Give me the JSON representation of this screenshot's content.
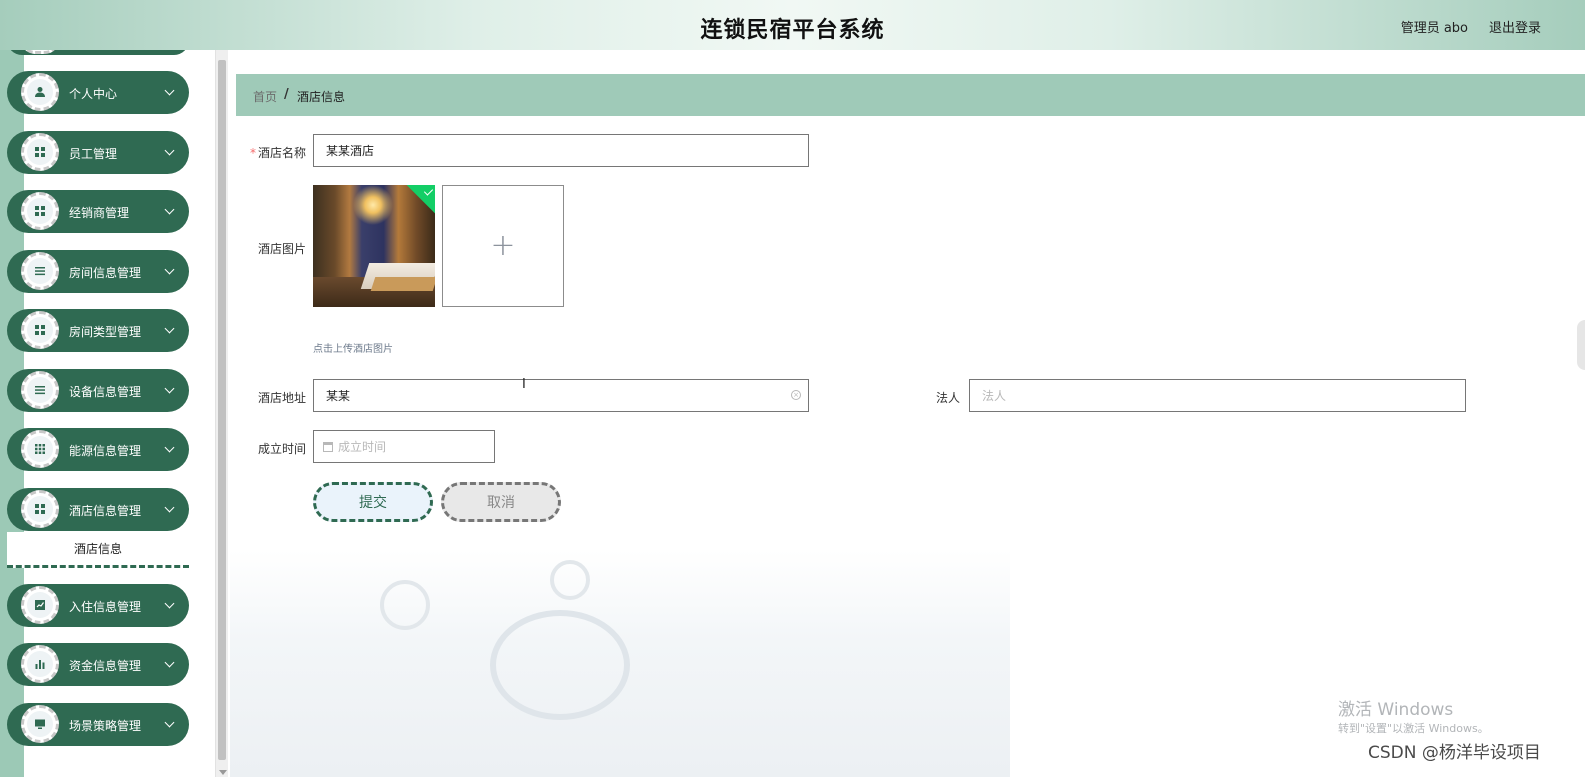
{
  "header": {
    "title": "连锁民宿平台系统",
    "user": "管理员 abo",
    "logout": "退出登录"
  },
  "sidebar": {
    "items": [
      {
        "label": "个人中心",
        "icon": "person-icon"
      },
      {
        "label": "员工管理",
        "icon": "grid-icon"
      },
      {
        "label": "经销商管理",
        "icon": "grid-icon"
      },
      {
        "label": "房间信息管理",
        "icon": "list-icon"
      },
      {
        "label": "房间类型管理",
        "icon": "grid-icon"
      },
      {
        "label": "设备信息管理",
        "icon": "list-icon"
      },
      {
        "label": "能源信息管理",
        "icon": "grid-dots-icon"
      },
      {
        "label": "酒店信息管理",
        "icon": "grid-icon"
      },
      {
        "label": "入住信息管理",
        "icon": "chart-line-icon"
      },
      {
        "label": "资金信息管理",
        "icon": "bar-chart-icon"
      },
      {
        "label": "场景策略管理",
        "icon": "monitor-icon"
      }
    ],
    "active_submenu": "酒店信息"
  },
  "breadcrumb": {
    "home": "首页",
    "separator": "/",
    "current": "酒店信息"
  },
  "form": {
    "hotel_name": {
      "label": "酒店名称",
      "required_mark": "*",
      "value": "某某酒店"
    },
    "hotel_image": {
      "label": "酒店图片",
      "tip": "点击上传酒店图片"
    },
    "hotel_address": {
      "label": "酒店地址",
      "value": "某某"
    },
    "legal_person": {
      "label": "法人",
      "placeholder": "法人",
      "value": ""
    },
    "founded_time": {
      "label": "成立时间",
      "placeholder": "成立时间",
      "value": ""
    },
    "submit_label": "提交",
    "cancel_label": "取消"
  },
  "overlay": {
    "activate_title": "激活 Windows",
    "activate_sub": "转到\"设置\"以激活 Windows。",
    "csdn": "CSDN @杨洋毕设项目"
  },
  "colors": {
    "accent": "#2f6a52",
    "breadcrumb_bg": "#9fcab8",
    "required": "#f56c6c",
    "success": "#13ce66"
  }
}
